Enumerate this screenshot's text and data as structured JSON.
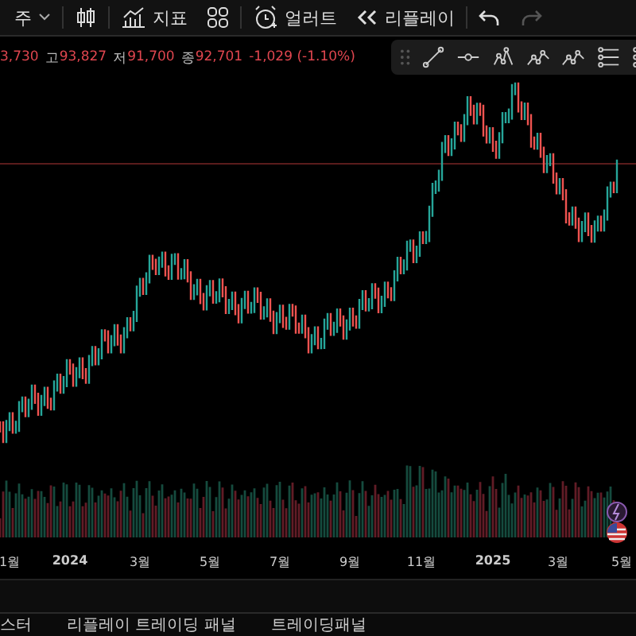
{
  "toolbar": {
    "interval": "주",
    "buttons": [
      {
        "kind": "candles",
        "disabled": false
      },
      {
        "kind": "indicators",
        "label": "지표",
        "disabled": false
      },
      {
        "kind": "layout",
        "disabled": false
      },
      {
        "kind": "alert",
        "label": "얼러트",
        "disabled": false
      },
      {
        "kind": "replay",
        "label": "리플레이",
        "disabled": false
      },
      {
        "kind": "undo",
        "disabled": false
      },
      {
        "kind": "redo",
        "disabled": true
      }
    ]
  },
  "legend": {
    "first_value": "3,730",
    "items": [
      {
        "label": "고",
        "value": "93,827"
      },
      {
        "label": "저",
        "value": "91,700"
      },
      {
        "label": "종",
        "value": "92,701"
      }
    ],
    "change": "-1,029 (-1.10%)"
  },
  "drawing_tools": [
    {
      "kind": "trend"
    },
    {
      "kind": "ray"
    },
    {
      "kind": "pattern"
    },
    {
      "kind": "wave"
    },
    {
      "kind": "wave"
    },
    {
      "kind": "lines"
    },
    {
      "kind": "lines"
    }
  ],
  "time_axis": [
    "1월",
    "2024",
    "3월",
    "5월",
    "7월",
    "9월",
    "11월",
    "2025",
    "3월",
    "5월"
  ],
  "bottom_tabs": [
    "스터",
    "리플레이 트레이딩 패널",
    "트레이딩패널"
  ]
}
